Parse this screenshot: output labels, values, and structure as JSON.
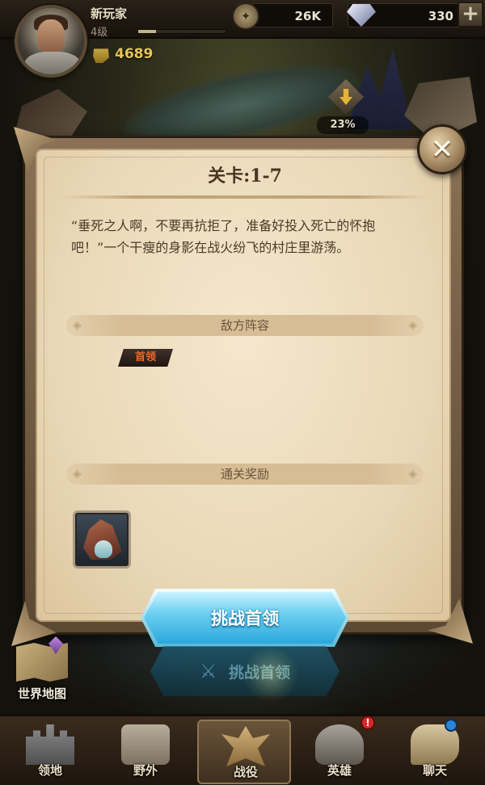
{
  "player": {
    "name": "新玩家",
    "level": "4级",
    "xp_fraction": 0.2,
    "power": "4689"
  },
  "resources": {
    "gold": "26K",
    "gems": "330",
    "plus": "+"
  },
  "tower": {
    "percent": "23%"
  },
  "dialog": {
    "title": "关卡:1-7",
    "description": "“垂死之人啊，不要再抗拒了，准备好投入死亡的怀抱吧！”一个干瘦的身影在战火纷飞的村庄里游荡。",
    "enemy_section": "敌方阵容",
    "boss_tag": "首领",
    "reward_section": "通关奖励",
    "reward_icon": "hood-icon",
    "close": "✕"
  },
  "buttons": {
    "challenge": "挑战首领",
    "challenge_ghost": "挑战首领"
  },
  "world_map": {
    "label": "世界地图"
  },
  "nav": {
    "items": [
      {
        "label": "领地",
        "icon": "castle-icon"
      },
      {
        "label": "野外",
        "icon": "scroll-icon"
      },
      {
        "label": "战役",
        "icon": "battle-icon"
      },
      {
        "label": "英雄",
        "icon": "hero-icon"
      },
      {
        "label": "聊天",
        "icon": "chat-icon"
      }
    ],
    "hero_alert": "!"
  },
  "colors": {
    "accent_button": "#2aa8dc",
    "parchment": "#ead9b8",
    "boss_tag_text": "#f06a2a"
  }
}
